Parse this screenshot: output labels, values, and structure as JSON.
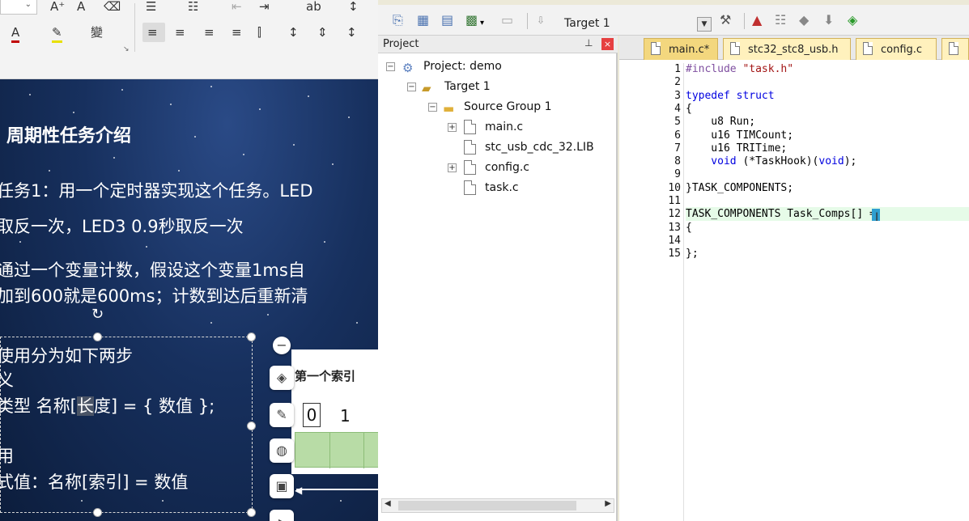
{
  "ribbon": {
    "font_size_value": "",
    "grow_font": "A⁺",
    "shrink_font": "A",
    "clear_format": "⌫",
    "bullets": "☰",
    "numbering": "☷",
    "decrease_indent": "⇤",
    "increase_indent": "⇥",
    "phonetic": "ab",
    "sort": "↕",
    "font_color": "A",
    "highlight": "✎",
    "char_border": "變",
    "align_left": "≡",
    "align_center": "≡",
    "align_right": "≡",
    "justify": "≡",
    "distributed": "⫿",
    "line_spacing": "↕",
    "para_spacing": "⇕",
    "more_spacing": "↕"
  },
  "slide": {
    "title": "周期性任务介绍",
    "line1": "任务1：用一个定时器实现这个任务。LED",
    "line2": "取反一次，LED3 0.9秒取反一次",
    "line3": "通过一个变量计数，假设这个变量1ms自",
    "line4": "加到600就是600ms；计数到达后重新清",
    "box_line1": "使用分为如下两步",
    "box_line2": "义",
    "box_line3_a": "类型 名称[",
    "box_line3_hl": "长",
    "box_line3_b": "度] = { 数值 };",
    "box_line4": "用",
    "box_line5": "式值：名称[索引] = 数值",
    "diagram_label": "第一个索引",
    "diagram_cell0": "0",
    "diagram_cell1": "1"
  },
  "ide": {
    "target_name": "Target 1",
    "project_panel_title": "Project",
    "tree": [
      {
        "label": "Project: demo"
      },
      {
        "label": "Target 1"
      },
      {
        "label": "Source Group 1"
      },
      {
        "label": "main.c"
      },
      {
        "label": "stc_usb_cdc_32.LIB"
      },
      {
        "label": "config.c"
      },
      {
        "label": "task.c"
      }
    ],
    "tabs": [
      {
        "label": "main.c*"
      },
      {
        "label": "stc32_stc8_usb.h"
      },
      {
        "label": "config.c"
      }
    ],
    "line_numbers": [
      "1",
      "2",
      "3",
      "4",
      "5",
      "6",
      "7",
      "8",
      "9",
      "10",
      "11",
      "12",
      "13",
      "14",
      "15"
    ],
    "code": {
      "l1_pp": "#include ",
      "l1_str": "\"task.h\"",
      "l3_kw": "typedef struct",
      "l4": "{",
      "l5": "    u8 Run;",
      "l6": "    u16 TIMCount;",
      "l7": "    u16 TRITime;",
      "l8_kw1": "    void",
      "l8_mid": " (*TaskHook)(",
      "l8_kw2": "void",
      "l8_end": ");",
      "l10": "}TASK_COMPONENTS;",
      "l12": "TASK_COMPONENTS Task_Comps[] =",
      "l13": "{",
      "l15": "};"
    }
  }
}
